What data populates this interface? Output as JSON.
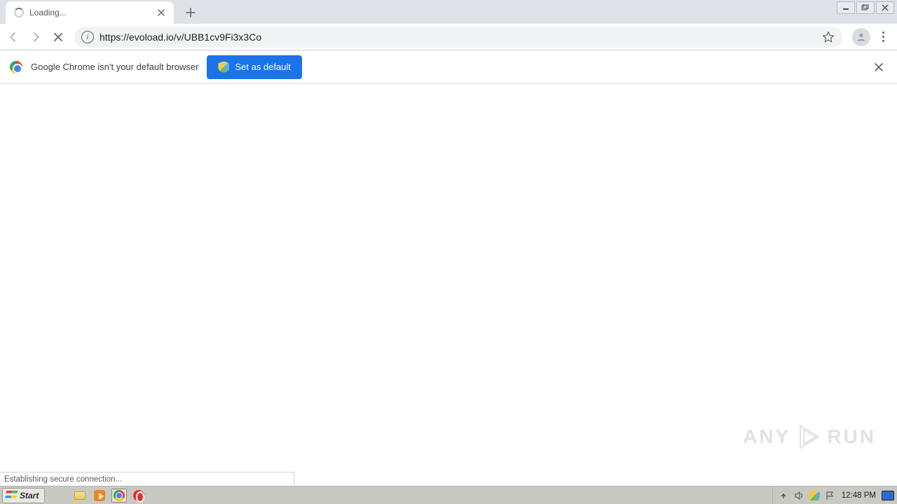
{
  "tab": {
    "title": "Loading..."
  },
  "toolbar": {
    "url": "https://evoload.io/v/UBB1cv9Fi3x3Co"
  },
  "infobar": {
    "message": "Google Chrome isn't your default browser",
    "button_label": "Set as default"
  },
  "status": {
    "text": "Establishing secure connection..."
  },
  "watermark": {
    "left": "ANY",
    "right": "RUN"
  },
  "taskbar": {
    "start_label": "Start",
    "time": "12:48 PM"
  }
}
